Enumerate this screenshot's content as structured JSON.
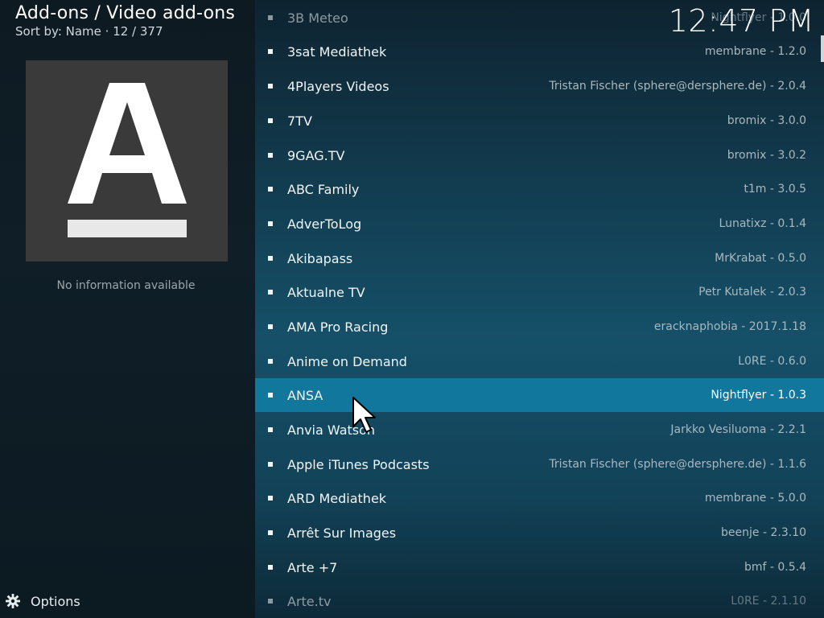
{
  "header": {
    "breadcrumb": "Add-ons / Video add-ons",
    "sort_info": "Sort by: Name  ·  12 / 377",
    "clock": "12:47 PM"
  },
  "left_panel": {
    "thumbnail_icon": "letter-a-logo",
    "no_info": "No information available",
    "options_label": "Options",
    "options_icon": "gear-icon"
  },
  "list": {
    "items": [
      {
        "name": "3B Meteo",
        "meta": "Nightflyer - 1.0.0"
      },
      {
        "name": "3sat Mediathek",
        "meta": "membrane - 1.2.0"
      },
      {
        "name": "4Players Videos",
        "meta": "Tristan Fischer (sphere@dersphere.de) - 2.0.4"
      },
      {
        "name": "7TV",
        "meta": "bromix - 3.0.0"
      },
      {
        "name": "9GAG.TV",
        "meta": "bromix - 3.0.2"
      },
      {
        "name": "ABC Family",
        "meta": "t1m - 3.0.5"
      },
      {
        "name": "AdverToLog",
        "meta": "Lunatixz - 0.1.4"
      },
      {
        "name": "Akibapass",
        "meta": "MrKrabat - 0.5.0"
      },
      {
        "name": "Aktualne TV",
        "meta": "Petr Kutalek - 2.0.3"
      },
      {
        "name": "AMA Pro Racing",
        "meta": "eracknaphobia - 2017.1.18"
      },
      {
        "name": "Anime on Demand",
        "meta": "L0RE - 0.6.0"
      },
      {
        "name": "ANSA",
        "meta": "Nightflyer - 1.0.3"
      },
      {
        "name": "Anvia Watson",
        "meta": "Jarkko Vesiluoma - 2.2.1"
      },
      {
        "name": "Apple iTunes Podcasts",
        "meta": "Tristan Fischer (sphere@dersphere.de) - 1.1.6"
      },
      {
        "name": "ARD Mediathek",
        "meta": "membrane - 5.0.0"
      },
      {
        "name": "Arrêt Sur Images",
        "meta": "beenje - 2.3.10"
      },
      {
        "name": "Arte +7",
        "meta": "bmf - 0.5.4"
      },
      {
        "name": "Arte.tv",
        "meta": "L0RE - 2.1.10"
      }
    ]
  },
  "colors": {
    "selected_row": "#12779d",
    "list_bg_mid": "#155069",
    "left_bg": "#0d1a22"
  }
}
